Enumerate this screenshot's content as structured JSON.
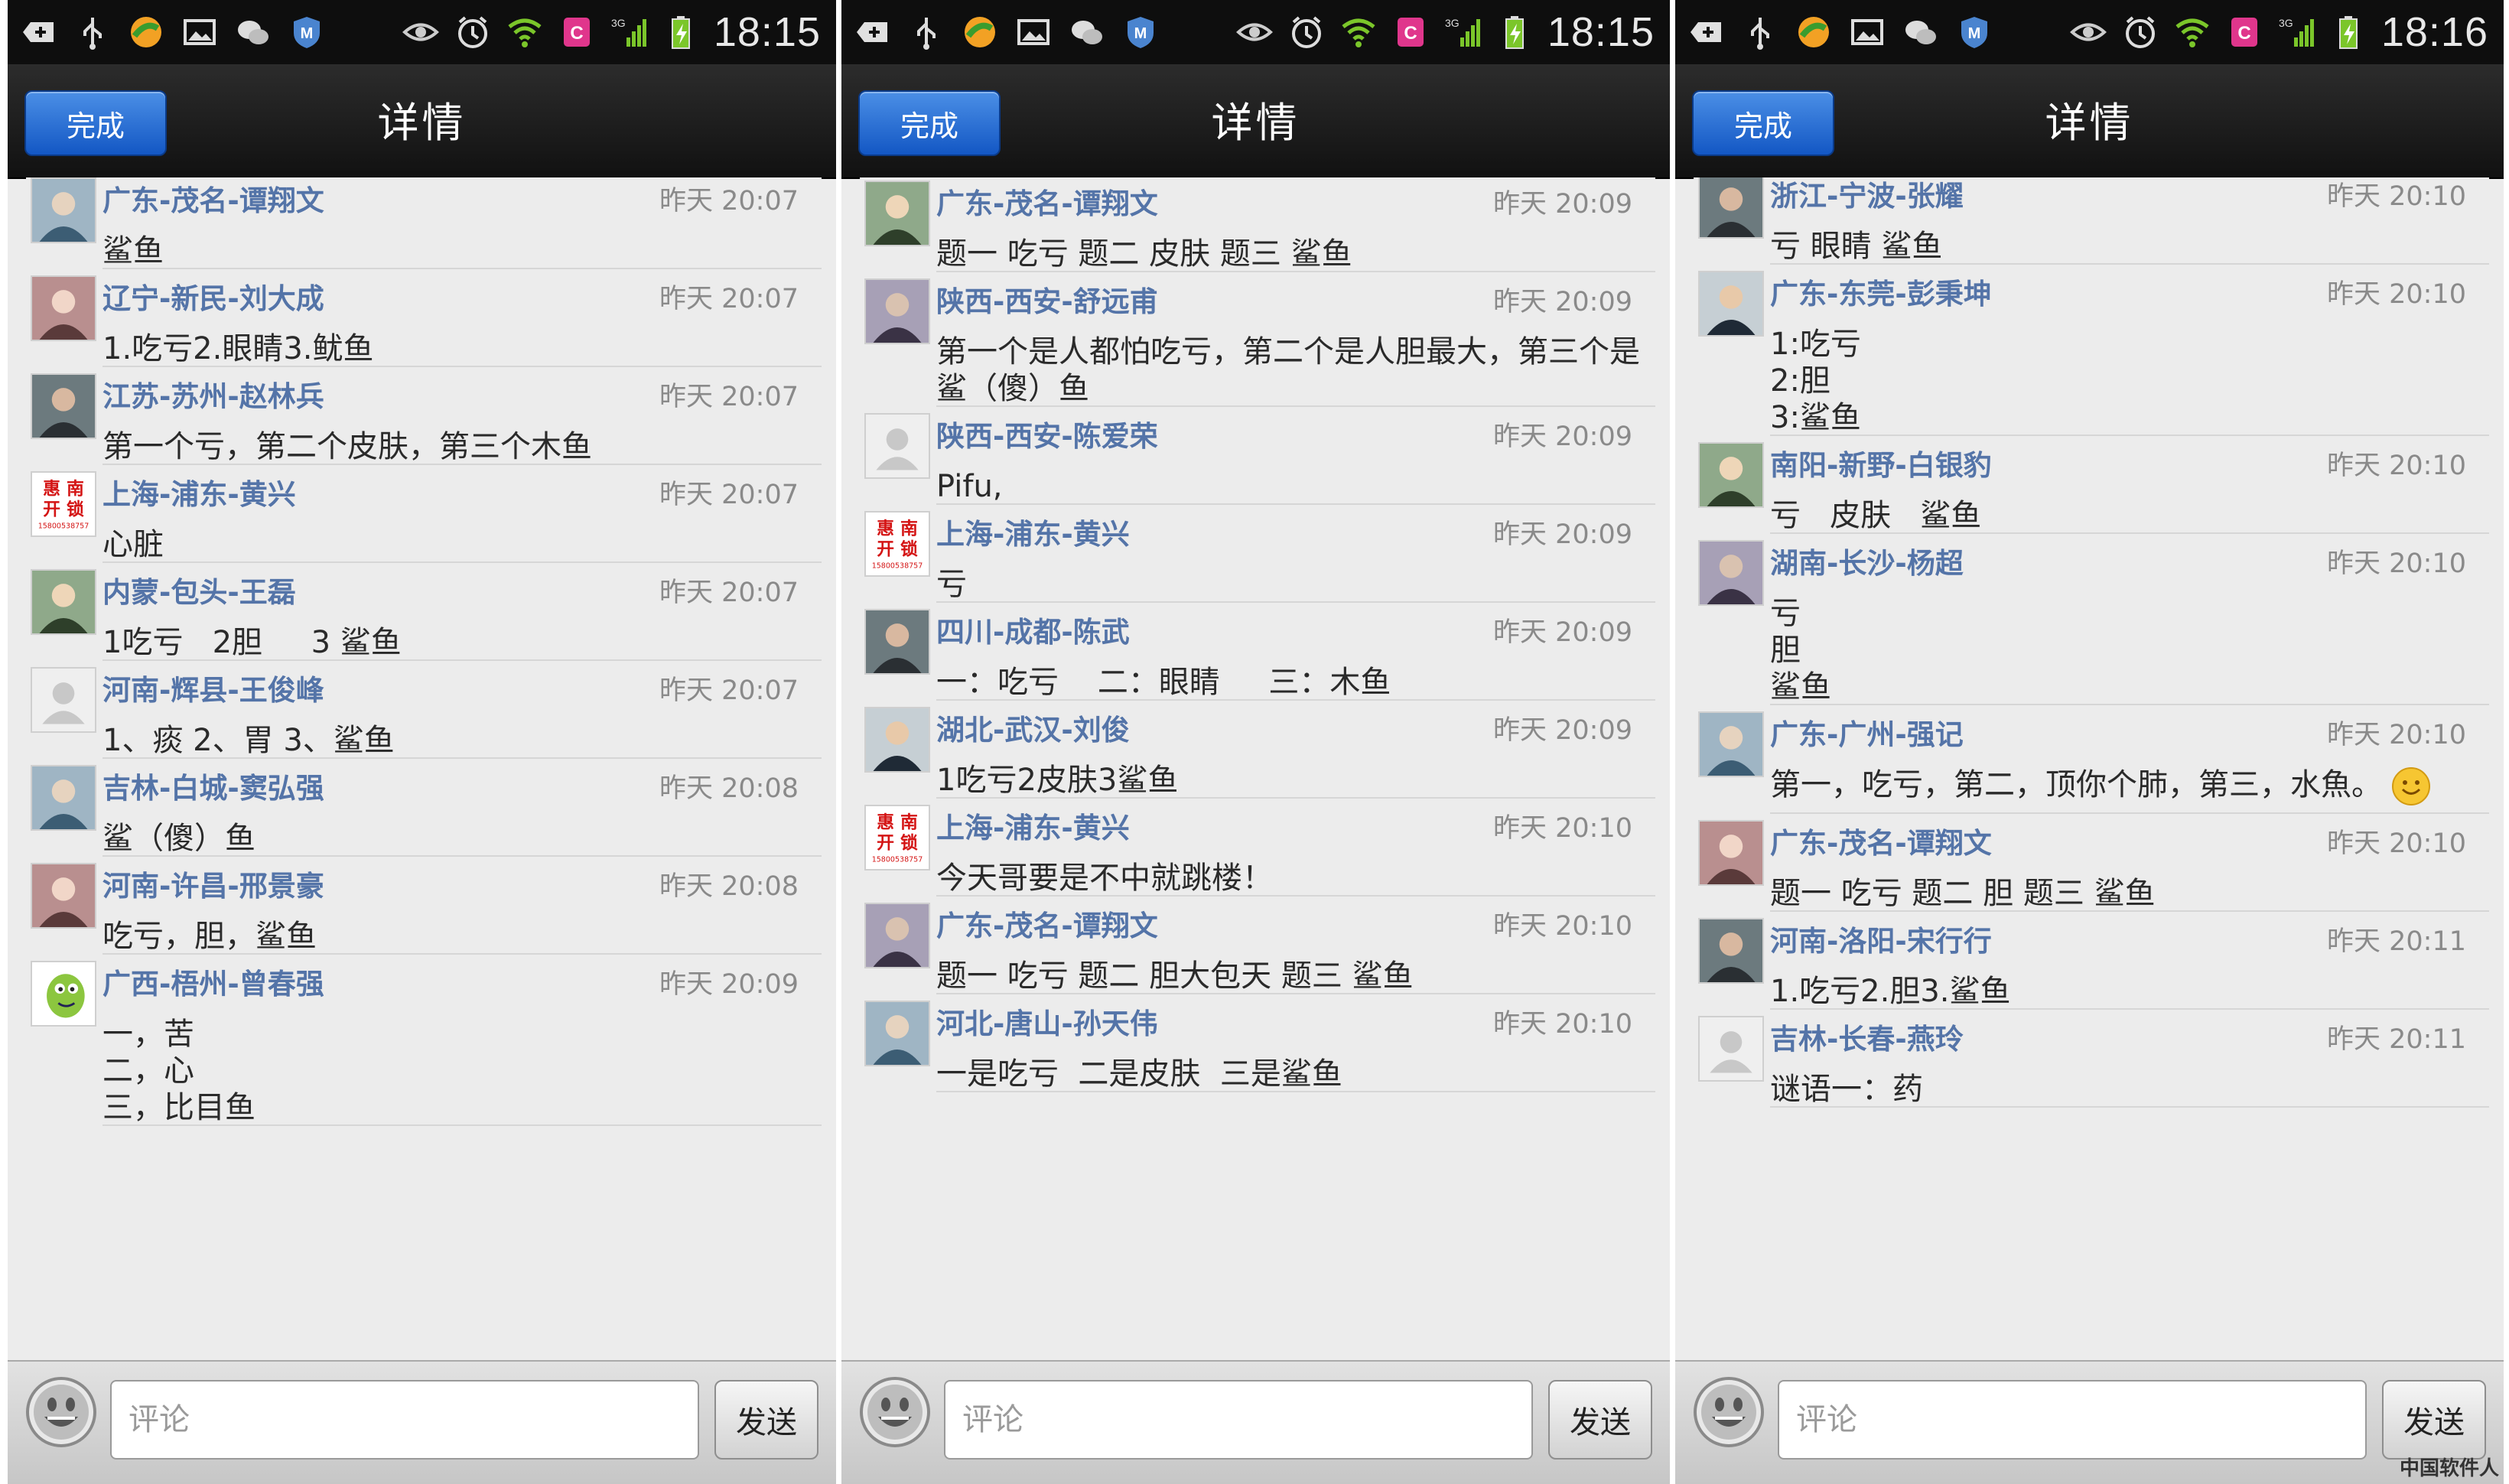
{
  "colors": {
    "name_link": "#5474a8",
    "time_gray": "#8a8a8a",
    "done_blue": "#2a74d8",
    "statusbar_bg": "#0e0e0e"
  },
  "status_icons": [
    "add-icon",
    "usb-icon",
    "app-ball-icon",
    "picture-icon",
    "wechat-icon",
    "shield-m-icon",
    "eye-icon",
    "alarm-icon",
    "wifi-icon",
    "app-c-icon",
    "signal-3g-icon",
    "battery-charging-icon"
  ],
  "signal_label": "3G",
  "screens": [
    {
      "status_time": "18:15",
      "done_label": "完成",
      "title": "详情",
      "placeholder": "评论",
      "send_label": "发送",
      "avatars": [
        "photo",
        "photo",
        "photo",
        "sign",
        "photo",
        "default",
        "photo",
        "photo",
        "cartoon"
      ],
      "comments": [
        {
          "name": "广东-茂名-谭翔文",
          "time": "昨天 20:07",
          "text": "鲨鱼"
        },
        {
          "name": "辽宁-新民-刘大成",
          "time": "昨天 20:07",
          "text": "1.吃亏2.眼睛3.鱿鱼"
        },
        {
          "name": "江苏-苏州-赵林兵",
          "time": "昨天 20:07",
          "text": "第一个亏，第二个皮肤，第三个木鱼"
        },
        {
          "name": "上海-浦东-黄兴",
          "time": "昨天 20:07",
          "text": "心脏"
        },
        {
          "name": "内蒙-包头-王磊",
          "time": "昨天 20:07",
          "text": "1吃亏   2胆     3 鲨鱼"
        },
        {
          "name": "河南-辉县-王俊峰",
          "time": "昨天 20:07",
          "text": "1、痰 2、胃 3、鲨鱼"
        },
        {
          "name": "吉林-白城-窦弘强",
          "time": "昨天 20:08",
          "text": "鲨（傻）鱼"
        },
        {
          "name": "河南-许昌-邢景豪",
          "time": "昨天 20:08",
          "text": "吃亏，胆，鲨鱼"
        },
        {
          "name": "广西-梧州-曾春强",
          "time": "昨天 20:09",
          "text": "一，苦\n二，心\n三，比目鱼"
        }
      ]
    },
    {
      "status_time": "18:15",
      "done_label": "完成",
      "title": "详情",
      "placeholder": "评论",
      "send_label": "发送",
      "avatars": [
        "photo",
        "photo",
        "default",
        "sign",
        "photo",
        "photo",
        "sign",
        "photo",
        "photo"
      ],
      "comments": [
        {
          "name": "广东-茂名-谭翔文",
          "time": "昨天 20:09",
          "text": "题一 吃亏 题二 皮肤 题三 鲨鱼"
        },
        {
          "name": "陕西-西安-舒远甫",
          "time": "昨天 20:09",
          "text": "第一个是人都怕吃亏，第二个是人胆最大，第三个是鲨（傻）鱼"
        },
        {
          "name": "陕西-西安-陈爱荣",
          "time": "昨天 20:09",
          "text": "Pifu,"
        },
        {
          "name": "上海-浦东-黄兴",
          "time": "昨天 20:09",
          "text": "亏"
        },
        {
          "name": "四川-成都-陈武",
          "time": "昨天 20:09",
          "text": "一：吃亏    二：眼睛     三：木鱼"
        },
        {
          "name": "湖北-武汉-刘俊",
          "time": "昨天 20:09",
          "text": "1吃亏2皮肤3鲨鱼"
        },
        {
          "name": "上海-浦东-黄兴",
          "time": "昨天 20:10",
          "text": "今天哥要是不中就跳楼！"
        },
        {
          "name": "广东-茂名-谭翔文",
          "time": "昨天 20:10",
          "text": "题一 吃亏 题二 胆大包天 题三 鲨鱼"
        },
        {
          "name": "河北-唐山-孙天伟",
          "time": "昨天 20:10",
          "text": "一是吃亏  二是皮肤  三是鲨鱼"
        }
      ]
    },
    {
      "status_time": "18:16",
      "done_label": "完成",
      "title": "详情",
      "placeholder": "评论",
      "send_label": "发送",
      "avatars": [
        "photo",
        "photo",
        "photo",
        "photo",
        "photo",
        "photo",
        "photo",
        "default"
      ],
      "comments": [
        {
          "name": "浙江-宁波-张耀",
          "time": "昨天 20:10",
          "text": "亏 眼睛 鲨鱼"
        },
        {
          "name": "广东-东莞-彭秉坤",
          "time": "昨天 20:10",
          "text": "1:吃亏\n2:胆\n3:鲨鱼"
        },
        {
          "name": "南阳-新野-白银豹",
          "time": "昨天 20:10",
          "text": "亏   皮肤   鲨鱼"
        },
        {
          "name": "湖南-长沙-杨超",
          "time": "昨天 20:10",
          "text": "亏\n胆\n鲨鱼"
        },
        {
          "name": "广东-广州-强记",
          "time": "昨天 20:10",
          "text": "第一，吃亏，第二，顶你个肺，第三，水魚。",
          "emoji": "smile-emoji-icon"
        },
        {
          "name": "广东-茂名-谭翔文",
          "time": "昨天 20:10",
          "text": "题一 吃亏 题二 胆 题三 鲨鱼"
        },
        {
          "name": "河南-洛阳-宋行行",
          "time": "昨天 20:11",
          "text": "1.吃亏2.胆3.鲨鱼"
        },
        {
          "name": "吉林-长春-燕玲",
          "time": "昨天 20:11",
          "text": "谜语一：药"
        }
      ]
    }
  ],
  "sign_avatar_lines": [
    "惠 南",
    "开 锁",
    "15800538757"
  ],
  "watermark": "中国软件人"
}
